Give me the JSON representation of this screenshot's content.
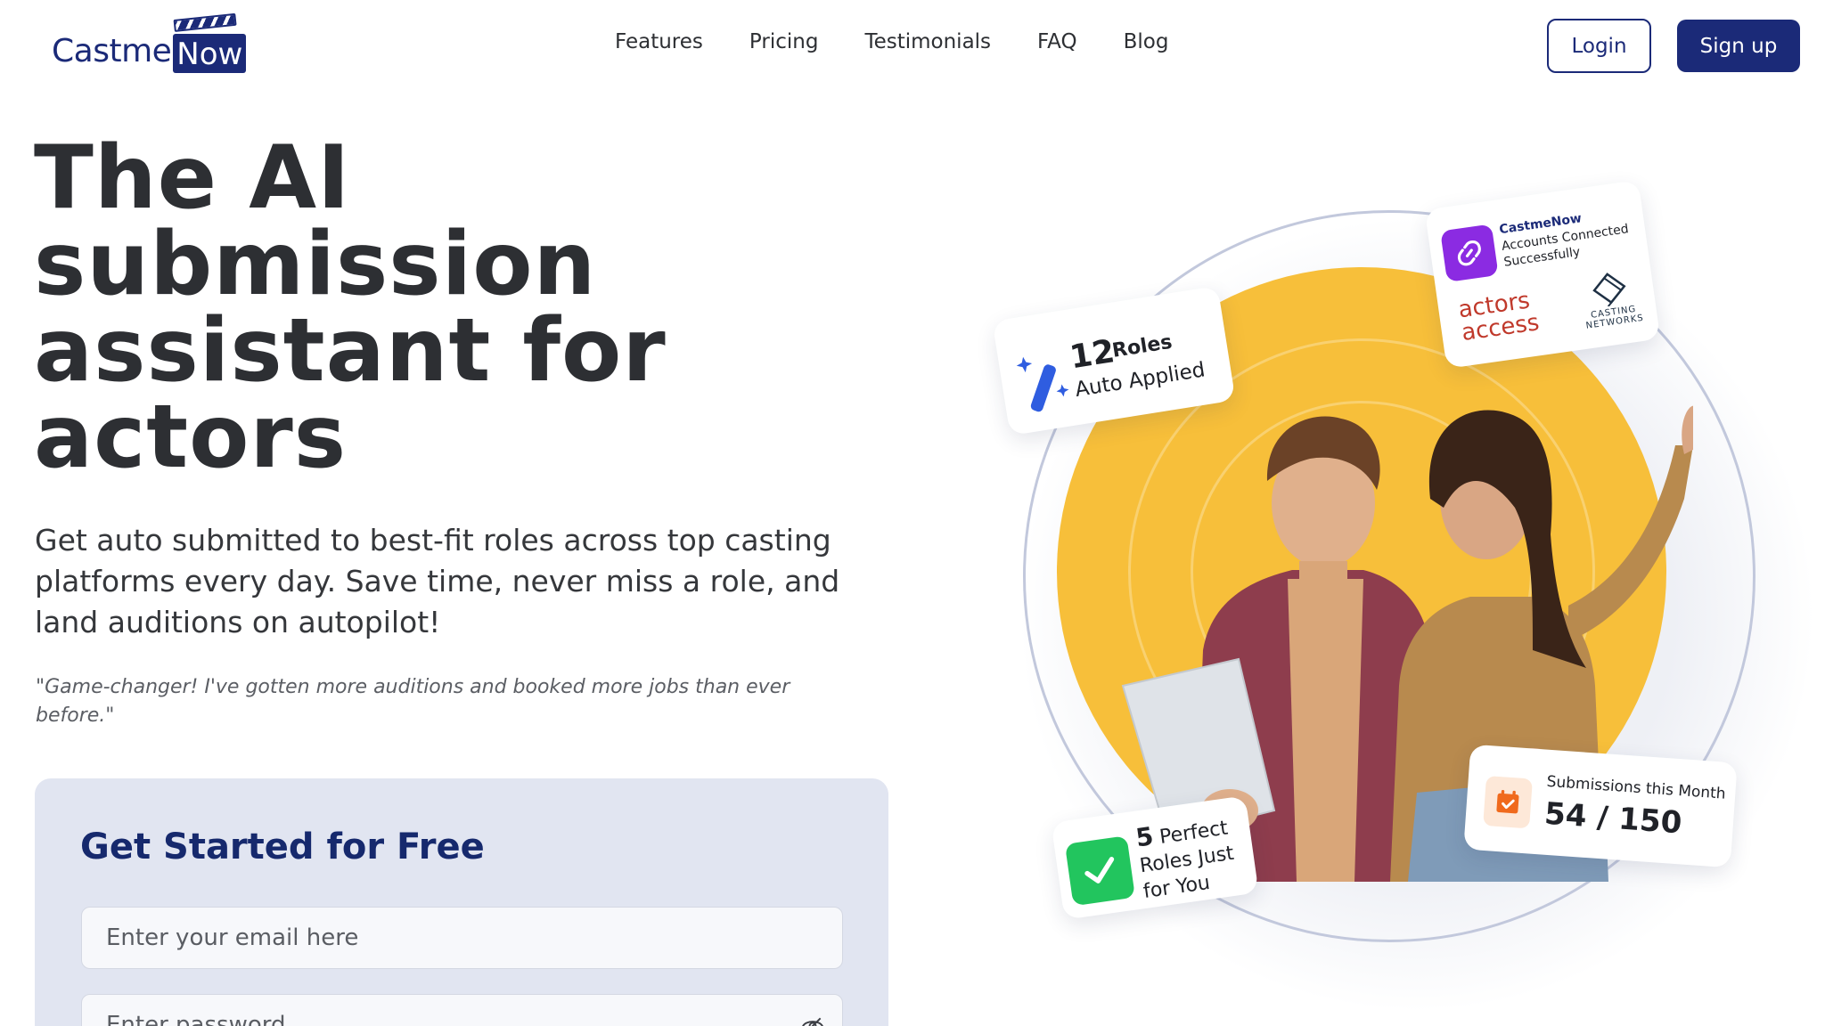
{
  "brand": {
    "logo_part1": "Castme",
    "logo_part2": "Now"
  },
  "nav": {
    "links": [
      "Features",
      "Pricing",
      "Testimonials",
      "FAQ",
      "Blog"
    ],
    "login_label": "Login",
    "signup_label": "Sign up"
  },
  "hero": {
    "headline": "The AI submission assistant for actors",
    "subcopy": "Get auto submitted to best-fit roles across top casting platforms every day. Save time, never miss a role, and land auditions on autopilot!",
    "quote": "\"Game-changer! I've gotten more auditions and booked more jobs than ever before.\""
  },
  "signup_card": {
    "title": "Get Started for Free",
    "email_placeholder": "Enter your email here",
    "password_placeholder": "Enter password"
  },
  "badges": {
    "roles": {
      "count": "12",
      "label1": "Roles",
      "label2": "Auto Applied"
    },
    "accounts": {
      "brand": "CastmeNow",
      "text": "Accounts Connected Successfully",
      "partner1": "actors access",
      "partner2": "CASTING NETWORKS"
    },
    "perfect": {
      "count": "5",
      "label": "Perfect Roles Just for You"
    },
    "submissions": {
      "label": "Submissions this Month",
      "value": "54 / 150",
      "used": 54,
      "limit": 150
    }
  },
  "colors": {
    "brand_navy": "#1b2a78",
    "accent_yellow": "#f7bf3a",
    "link_purple": "#8b2be2",
    "check_green": "#22c55e"
  },
  "icons": [
    "wand-icon",
    "link-icon",
    "check-icon",
    "calendar-check-icon",
    "eye-off-icon",
    "clapperboard-icon"
  ]
}
